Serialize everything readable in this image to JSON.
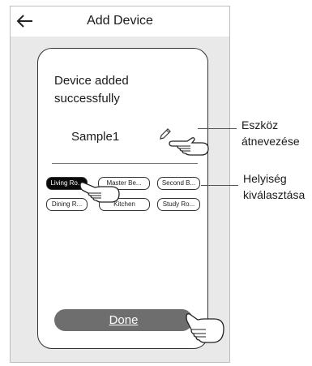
{
  "header": {
    "title": "Add Device",
    "back_icon": "back-arrow-icon"
  },
  "card": {
    "message": "Device added successfully",
    "device_name": "Sample1",
    "edit_icon": "pencil-icon"
  },
  "rooms": [
    {
      "label": "Living Ro...",
      "selected": true
    },
    {
      "label": "Master Be...",
      "selected": false
    },
    {
      "label": "Second B...",
      "selected": false
    },
    {
      "label": "Dining R...",
      "selected": false
    },
    {
      "label": "Kitchen",
      "selected": false
    },
    {
      "label": "Study Ro...",
      "selected": false
    }
  ],
  "done_label": "Done",
  "callouts": {
    "rename": [
      "Eszköz",
      "átnevezése"
    ],
    "room": [
      "Helyiség",
      "kiválasztása"
    ]
  },
  "colors": {
    "selected_room": "#0a0a0a",
    "done_button": "#6e6e6e",
    "screen_bg": "#e9e9e9"
  }
}
